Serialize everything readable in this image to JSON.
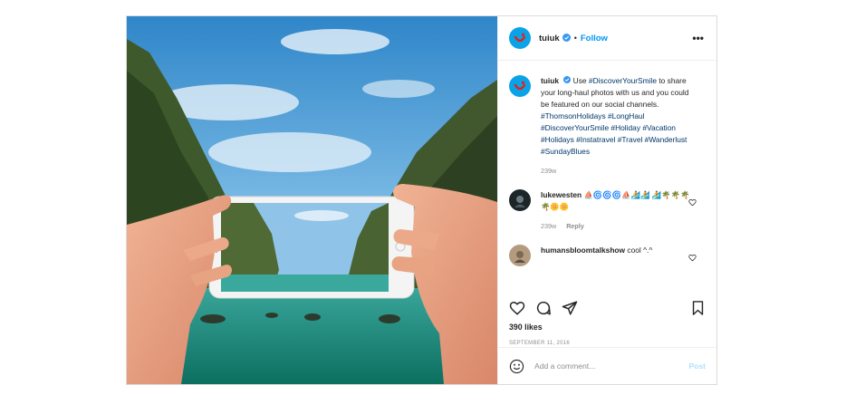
{
  "post": {
    "username": "tuiuk",
    "follow_label": "Follow",
    "separator": "•",
    "more_label": "•••",
    "caption": {
      "username": "tuiuk",
      "text_before": "Use",
      "tag_intro": "#DiscoverYourSmile",
      "text_after": "to share your long-haul photos with us and you could be featured on our social channels.",
      "hashtags": "#ThomsonHolidays #LongHaul #DiscoverYourSmile #Holiday #Vacation #Holidays #Instatravel #Travel #Wanderlust #SundayBlues",
      "age": "239w"
    },
    "comments": [
      {
        "username": "lukewesten",
        "text": "⛵🌀🌀🌀⛵🏄🏄 🏄🌴🌴🌴🌴🌼🌼",
        "age": "239w",
        "reply_label": "Reply"
      },
      {
        "username": "humansbloomtalkshow",
        "text": "cool ^.^"
      }
    ],
    "likes": "390 likes",
    "date": "SEPTEMBER 11, 2016",
    "add_comment_placeholder": "Add a comment...",
    "post_button": "Post"
  },
  "icons": {
    "like": "heart-icon",
    "comment": "comment-bubble-icon",
    "share": "paper-plane-icon",
    "save": "bookmark-icon",
    "emoji": "smiley-icon",
    "verified": "verified-badge-icon",
    "avatar": "tui-smile-logo"
  },
  "colors": {
    "link": "#0095f6",
    "hashtag": "#00376b",
    "muted": "#8e8e8e",
    "brand": "#0aa3e8"
  }
}
